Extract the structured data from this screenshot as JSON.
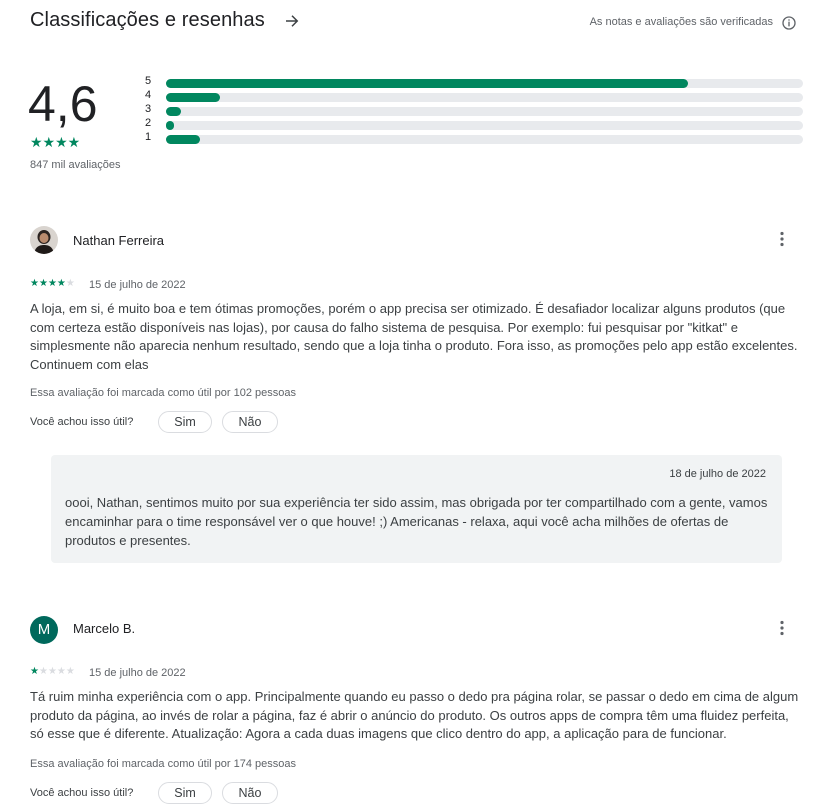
{
  "header": {
    "title": "Classificações e resenhas",
    "verified_note": "As notas e avaliações são verificadas",
    "arrow_icon": "arrow-right-icon",
    "info_icon": "info-icon"
  },
  "summary": {
    "rating": "4,6",
    "stars": "★★★★",
    "count": "847 mil avaliações",
    "distribution": [
      {
        "label": "5",
        "fraction": 0.82
      },
      {
        "label": "4",
        "fraction": 0.085
      },
      {
        "label": "3",
        "fraction": 0.023
      },
      {
        "label": "2",
        "fraction": 0.012
      },
      {
        "label": "1",
        "fraction": 0.054
      }
    ],
    "accent_color": "#01875f"
  },
  "reviews": [
    {
      "author": "Nathan Ferreira",
      "rating": 4,
      "date": "15 de julho de 2022",
      "text": "A loja, em si, é muito boa e tem ótimas promoções, porém o app precisa ser otimizado. É desafiador localizar alguns produtos (que com certeza estão disponíveis nas lojas), por causa do falho sistema de pesquisa. Por exemplo: fui pesquisar por \"kitkat\" e simplesmente não aparecia nenhum resultado, sendo que a loja tinha o produto. Fora isso, as promoções pelo app estão excelentes. Continuem com elas",
      "helpful_count": "Essa avaliação foi marcada como útil por 102 pessoas",
      "helpful_question": "Você achou isso útil?",
      "yes_label": "Sim",
      "no_label": "Não",
      "reply": {
        "date": "18 de julho de 2022",
        "text": "oooi, Nathan, sentimos muito por sua experiência ter sido assim, mas obrigada por ter compartilhado com a gente, vamos encaminhar para o time responsável ver o que houve! ;) Americanas - relaxa, aqui você acha milhões de ofertas de produtos e presentes."
      }
    },
    {
      "author": "Marcelo B.",
      "avatar_letter": "M",
      "rating": 1,
      "date": "15 de julho de 2022",
      "text": "Tá ruim minha experiência com o app. Principalmente quando eu passo o dedo pra página rolar, se passar o dedo em cima de algum produto da página, ao invés de rolar a página, faz é abrir o anúncio do produto. Os outros apps de compra têm uma fluidez perfeita, só esse que é diferente. Atualização: Agora a cada duas imagens que clico dentro do app, a aplicação para de funcionar.",
      "helpful_count": "Essa avaliação foi marcada como útil por 174 pessoas",
      "helpful_question": "Você achou isso útil?",
      "yes_label": "Sim",
      "no_label": "Não"
    }
  ]
}
